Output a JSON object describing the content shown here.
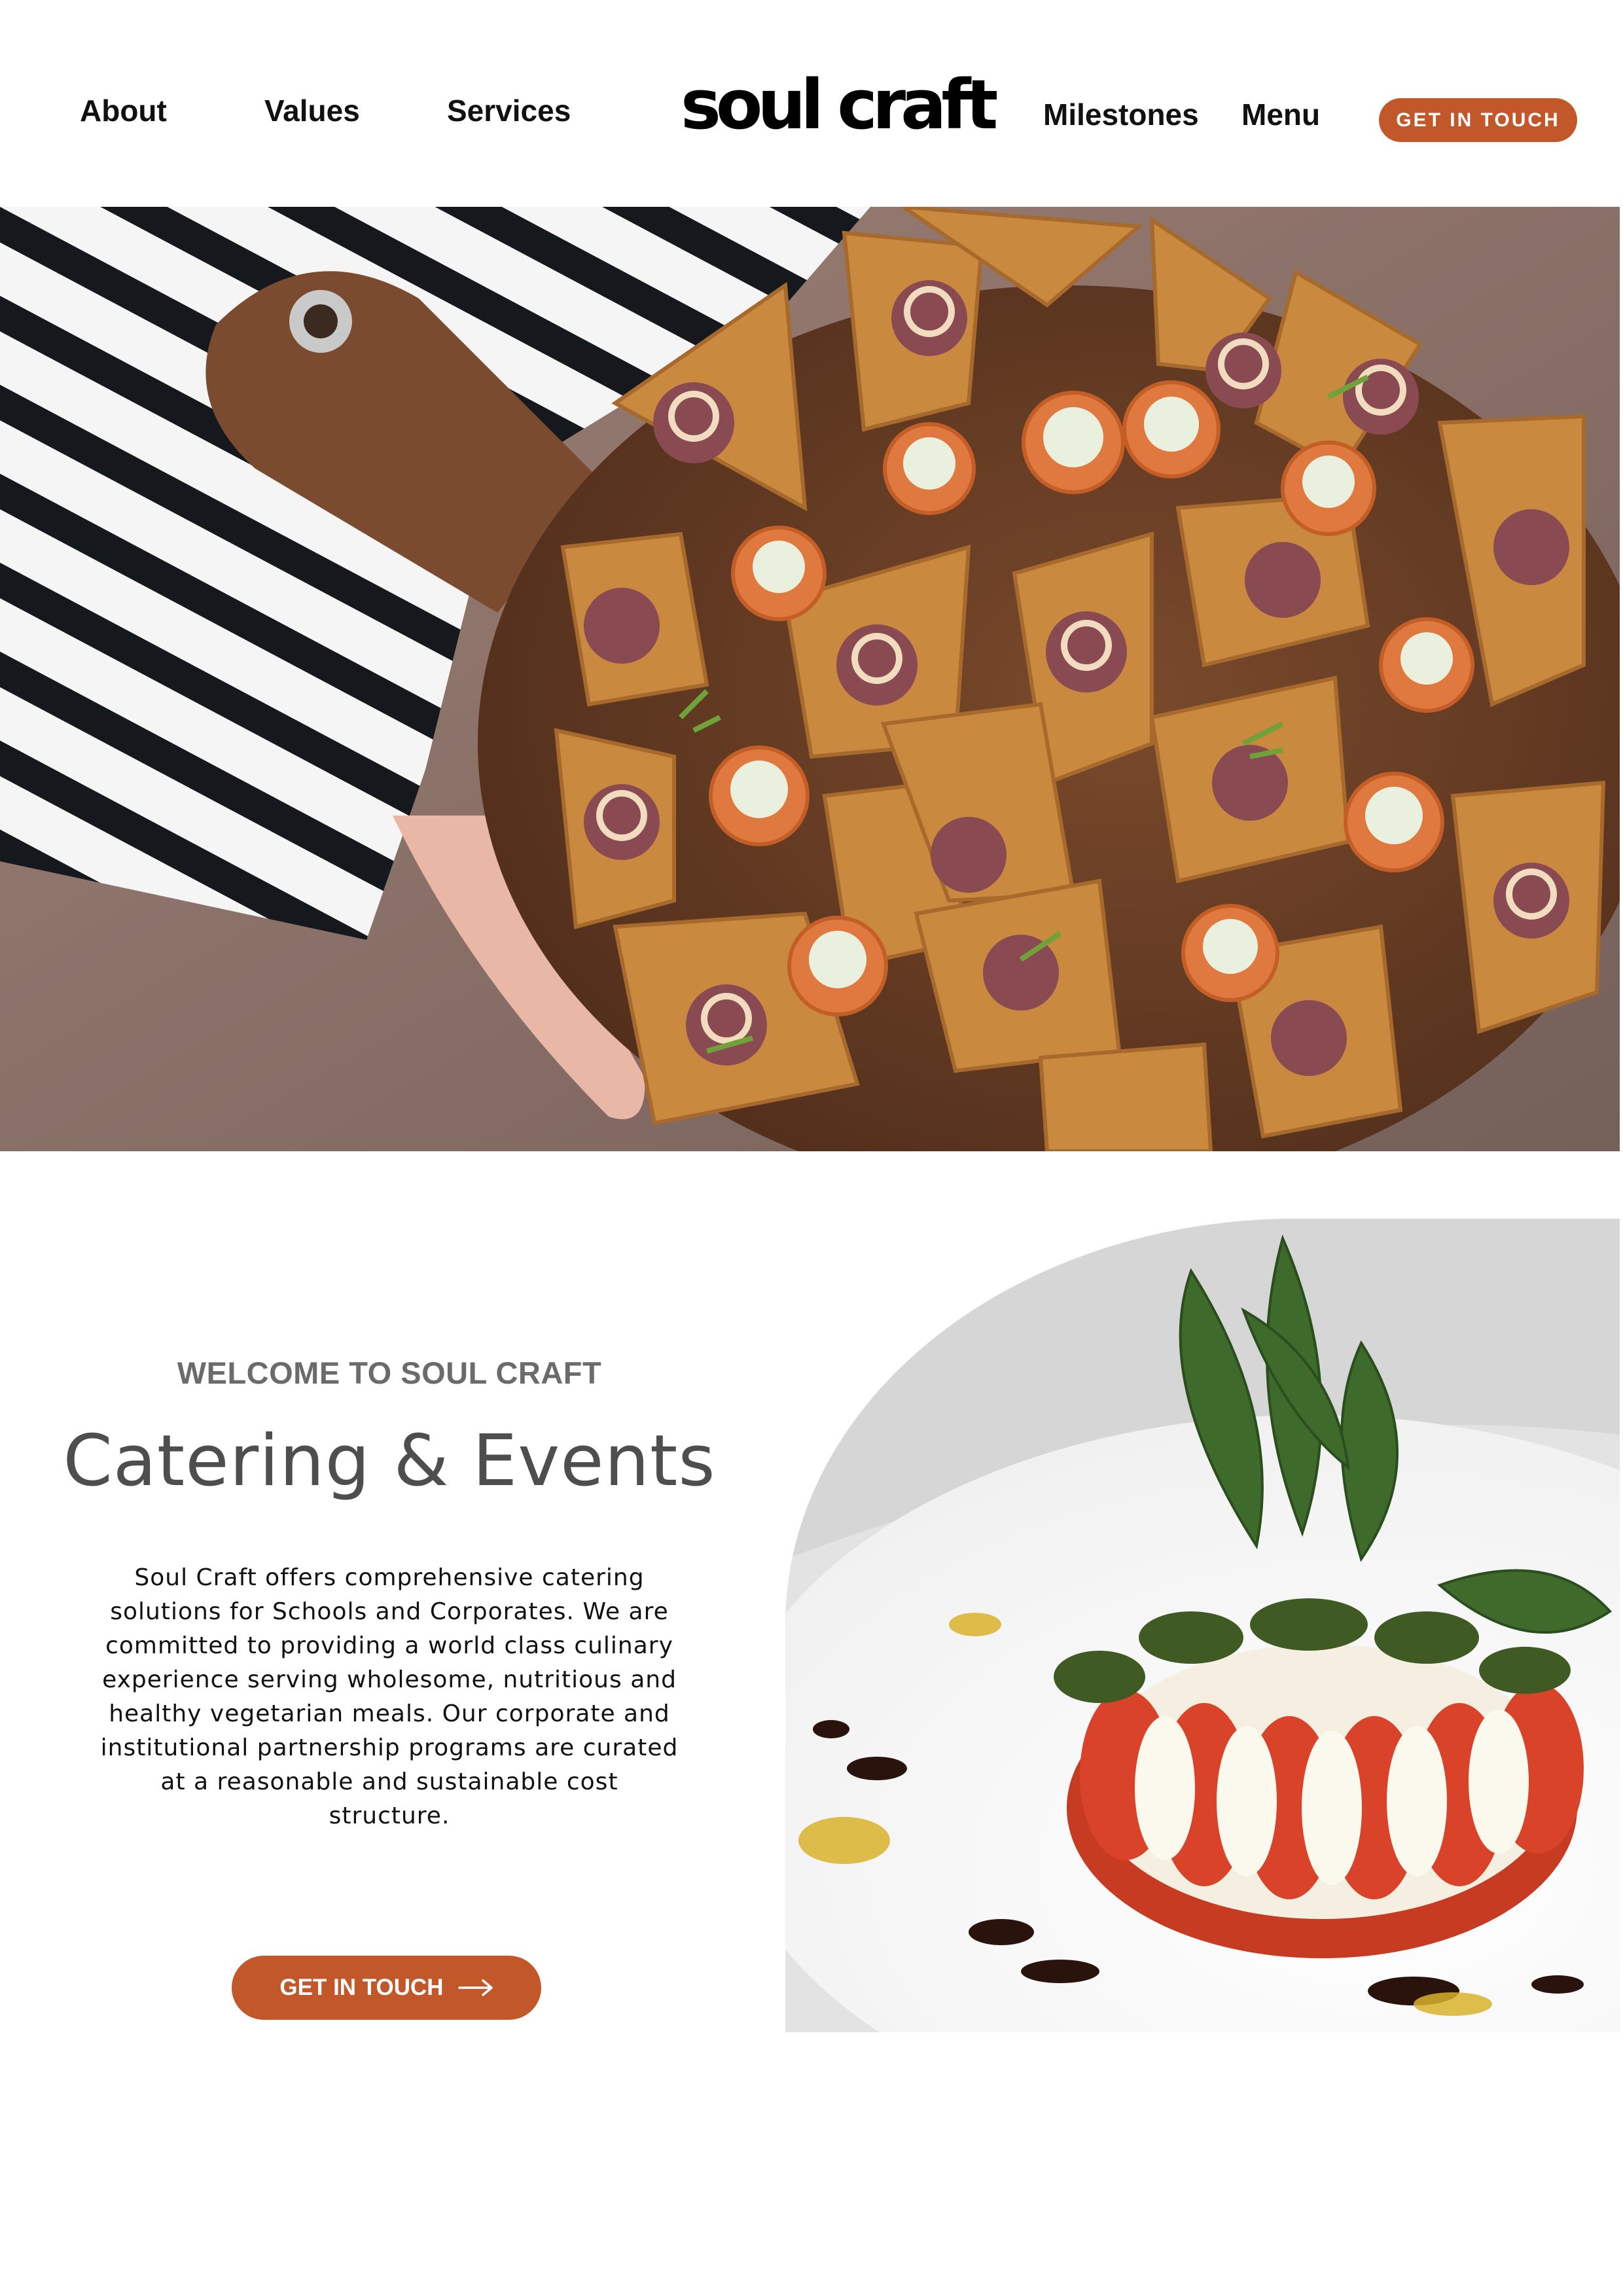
{
  "nav": {
    "links": [
      "About",
      "Values",
      "Services",
      "Milestones",
      "Menu"
    ],
    "logo": "soul craft",
    "cta_label": "GET IN TOUCH"
  },
  "intro": {
    "eyebrow": "WELCOME TO SOUL CRAFT",
    "headline": "Catering & Events",
    "body": "Soul Craft offers comprehensive catering solutions for Schools and Corporates. We are committed to providing a world class culinary experience serving wholesome, nutritious and healthy vegetarian meals. Our corporate and institutional partnership programs are curated at a reasonable and sustainable cost structure.",
    "cta_label": "GET IN TOUCH"
  },
  "icons": {
    "cta_arrow": "arrow-right-icon"
  },
  "colors": {
    "accent": "#c2572a",
    "eyebrow": "#6b6b6b",
    "headline": "#4e4e4e"
  }
}
